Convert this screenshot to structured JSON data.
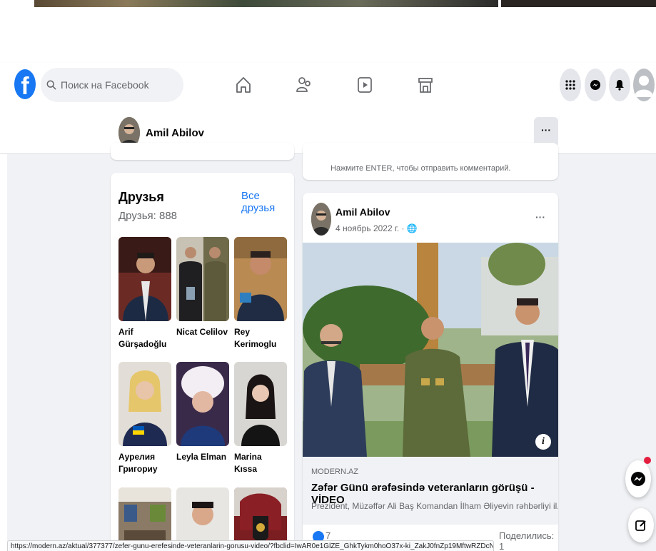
{
  "search": {
    "placeholder": "Поиск на Facebook"
  },
  "nav": {
    "icons": [
      "home-icon",
      "friends-icon",
      "video-icon",
      "marketplace-icon"
    ]
  },
  "header_right": {
    "icons": [
      "menu-icon",
      "messenger-icon",
      "notifications-icon",
      "account-icon"
    ]
  },
  "profile": {
    "name": "Amil Abilov",
    "more": "···"
  },
  "comment_hint": "Нажмите ENTER, чтобы отправить комментарий.",
  "friends": {
    "title": "Друзья",
    "count": "Друзья: 888",
    "all_link": "Все друзья",
    "items": [
      {
        "name": "Arif Gürşadoğlu"
      },
      {
        "name": "Nicat Celilov"
      },
      {
        "name": "Rey Kerimoglu"
      },
      {
        "name": "Аурелия Григориу"
      },
      {
        "name": "Leyla Elman"
      },
      {
        "name": "Marina Kıssa"
      },
      {
        "name": ""
      },
      {
        "name": ""
      },
      {
        "name": ""
      }
    ]
  },
  "post": {
    "author": "Amil Abilov",
    "date": "4 ноябрь 2022 г. · ",
    "more": "···",
    "link": {
      "domain": "MODERN.AZ",
      "title": "Zəfər Günü ərəfəsində veteranların görüşü - VİDEO",
      "description": "Prezident, Müzəffər Ali Baş Komandan İlham Əliyevin rəhbərliyi il..."
    },
    "likes": "7",
    "shares": "Поделились: 1"
  },
  "status_url": "https://modern.az/aktual/377377/zefer-gunu-erefesinde-veteranlarin-gorusu-video/?fbclid=IwAR0e1GlZE_GhkTykm0hoO37x-ki_ZakJ0fnZp19MftwRZDcNbNo_hWZlk94",
  "colors": {
    "accent": "#1877f2",
    "feed_bg": "#f0f2f5",
    "notification": "#e41e3f"
  }
}
